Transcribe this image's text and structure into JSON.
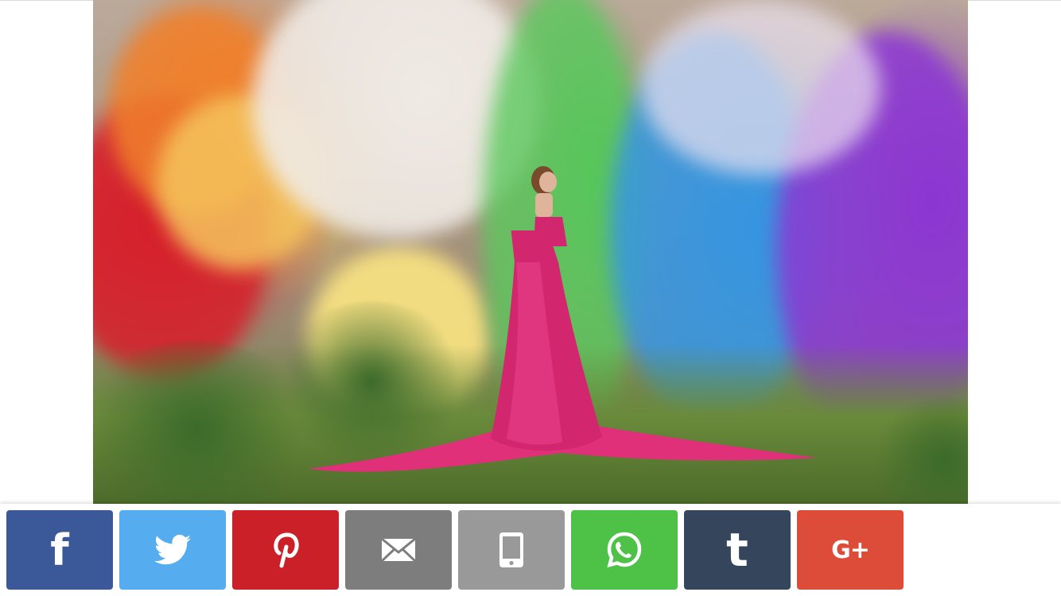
{
  "colors": {
    "facebook": "#3b5998",
    "twitter": "#55acee",
    "pinterest": "#cb2027",
    "email": "#7d7d7d",
    "sms": "#999999",
    "whatsapp": "#4dc247",
    "tumblr": "#35465c",
    "googleplus": "#dd4b39"
  },
  "share_bar": {
    "buttons": [
      {
        "id": "facebook",
        "icon": "facebook-icon",
        "glyph": "f"
      },
      {
        "id": "twitter",
        "icon": "twitter-icon",
        "glyph": ""
      },
      {
        "id": "pinterest",
        "icon": "pinterest-icon",
        "glyph": ""
      },
      {
        "id": "email",
        "icon": "envelope-icon",
        "glyph": ""
      },
      {
        "id": "sms",
        "icon": "phone-icon",
        "glyph": ""
      },
      {
        "id": "whatsapp",
        "icon": "whatsapp-icon",
        "glyph": ""
      },
      {
        "id": "tumblr",
        "icon": "tumblr-icon",
        "glyph": "t"
      },
      {
        "id": "googleplus",
        "icon": "google-plus-icon",
        "glyph": "G+"
      }
    ]
  }
}
